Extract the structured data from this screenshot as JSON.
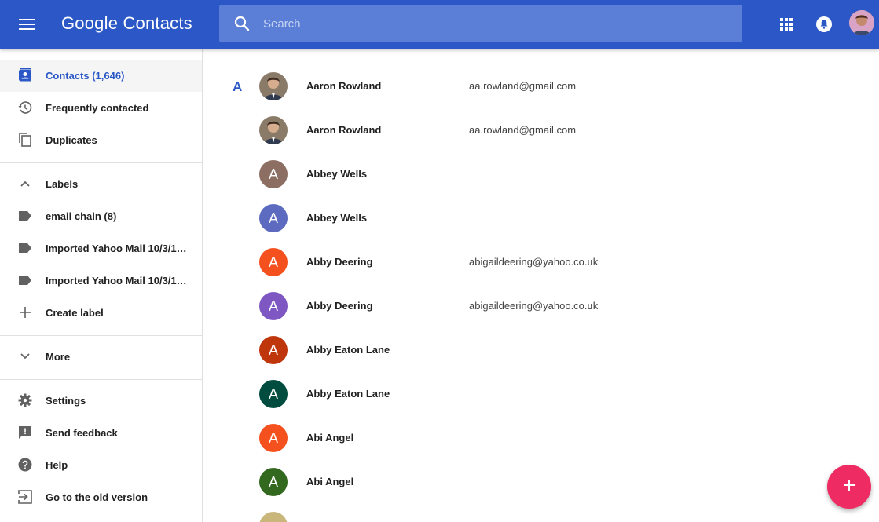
{
  "header": {
    "brand_google": "Google",
    "brand_product": "Contacts",
    "search_placeholder": "Search",
    "menu_icon": "hamburger-menu-icon",
    "apps_icon": "apps-grid-icon",
    "notifications_icon": "notifications-bell-icon"
  },
  "sidebar": {
    "primary": [
      {
        "label": "Contacts (1,646)",
        "icon": "contacts-icon",
        "active": true
      },
      {
        "label": "Frequently contacted",
        "icon": "history-icon"
      },
      {
        "label": "Duplicates",
        "icon": "copy-icon"
      }
    ],
    "labels_header": "Labels",
    "labels": [
      {
        "label": "email chain (8)",
        "icon": "label-icon"
      },
      {
        "label": "Imported Yahoo Mail 10/3/1…",
        "icon": "label-icon"
      },
      {
        "label": "Imported Yahoo Mail 10/3/1…",
        "icon": "label-icon"
      }
    ],
    "create_label": "Create label",
    "more": "More",
    "footer": [
      {
        "label": "Settings",
        "icon": "gear-icon"
      },
      {
        "label": "Send feedback",
        "icon": "feedback-icon"
      },
      {
        "label": "Help",
        "icon": "help-icon"
      },
      {
        "label": "Go to the old version",
        "icon": "exit-icon"
      }
    ]
  },
  "list": {
    "section_letter": "A",
    "contacts": [
      {
        "name": "Aaron Rowland",
        "email": "aa.rowland@gmail.com",
        "avatar": "photo",
        "color": "#6d5a4a"
      },
      {
        "name": "Aaron Rowland",
        "email": "aa.rowland@gmail.com",
        "avatar": "photo",
        "color": "#6d5a4a"
      },
      {
        "name": "Abbey Wells",
        "email": "",
        "avatar": "A",
        "color": "#8d6e63"
      },
      {
        "name": "Abbey Wells",
        "email": "",
        "avatar": "A",
        "color": "#5c6bc0"
      },
      {
        "name": "Abby Deering",
        "email": "abigaildeering@yahoo.co.uk",
        "avatar": "A",
        "color": "#f4511e"
      },
      {
        "name": "Abby Deering",
        "email": "abigaildeering@yahoo.co.uk",
        "avatar": "A",
        "color": "#7e57c2"
      },
      {
        "name": "Abby Eaton Lane",
        "email": "",
        "avatar": "A",
        "color": "#bf360c"
      },
      {
        "name": "Abby Eaton Lane",
        "email": "",
        "avatar": "A",
        "color": "#004d40"
      },
      {
        "name": "Abi Angel",
        "email": "",
        "avatar": "A",
        "color": "#f4511e"
      },
      {
        "name": "Abi Angel",
        "email": "",
        "avatar": "A",
        "color": "#33691e"
      }
    ]
  },
  "fab": {
    "icon": "plus-icon"
  },
  "colors": {
    "brand_blue": "#2b58c6",
    "fab_pink": "#ee2b62"
  }
}
